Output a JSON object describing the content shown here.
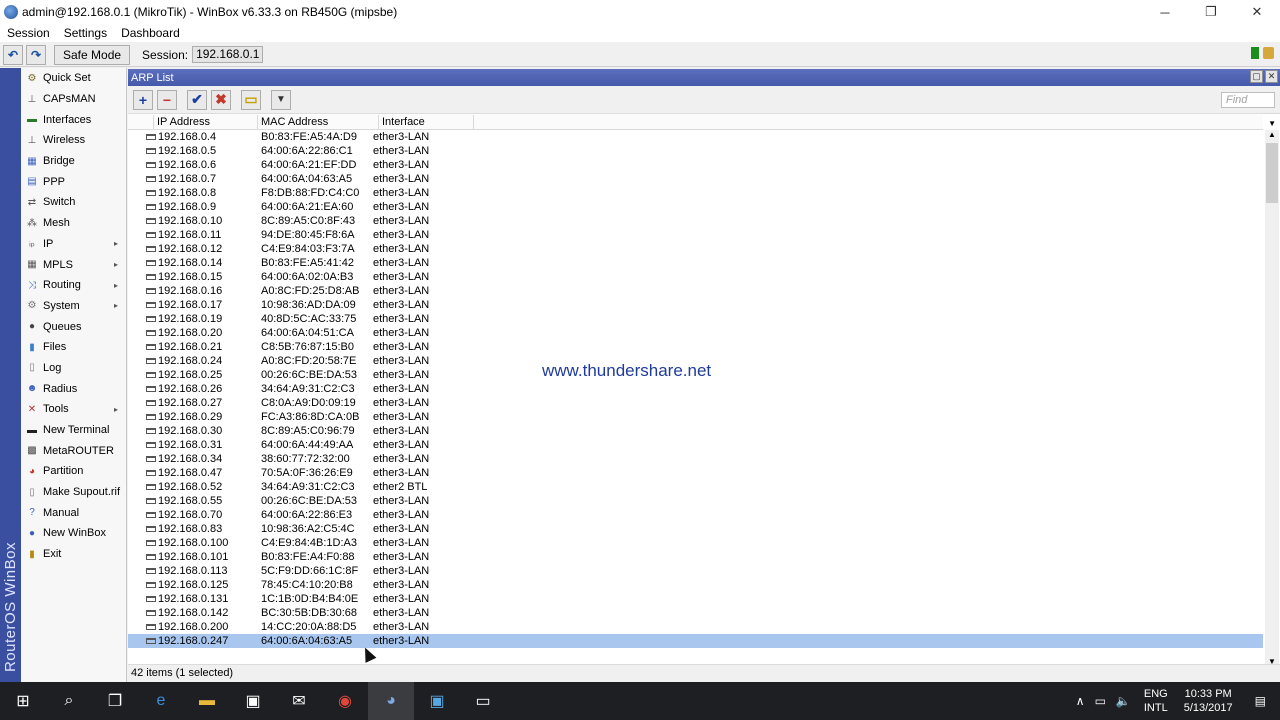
{
  "window": {
    "title": "admin@192.168.0.1 (MikroTik) - WinBox v6.33.3 on RB450G (mipsbe)",
    "minimize": "─",
    "maximize": "❐",
    "close": "✕"
  },
  "menubar": [
    "Session",
    "Settings",
    "Dashboard"
  ],
  "toolbar": {
    "undo": "↶",
    "redo": "↷",
    "safe_mode": "Safe Mode",
    "session_label": "Session:",
    "session_value": "192.168.0.1"
  },
  "brand": "RouterOS WinBox",
  "sidebar": [
    {
      "label": "Quick Set",
      "icon": "quick-set-icon",
      "glyph": "⚙",
      "color": "#7a6a2a",
      "arrow": ""
    },
    {
      "label": "CAPsMAN",
      "icon": "capsman-icon",
      "glyph": "⊥",
      "color": "#555",
      "arrow": ""
    },
    {
      "label": "Interfaces",
      "icon": "interfaces-icon",
      "glyph": "▬",
      "color": "#2a7a2a",
      "arrow": ""
    },
    {
      "label": "Wireless",
      "icon": "wireless-icon",
      "glyph": "⊥",
      "color": "#555",
      "arrow": ""
    },
    {
      "label": "Bridge",
      "icon": "bridge-icon",
      "glyph": "▦",
      "color": "#3a5fbf",
      "arrow": ""
    },
    {
      "label": "PPP",
      "icon": "ppp-icon",
      "glyph": "▤",
      "color": "#3a5fbf",
      "arrow": ""
    },
    {
      "label": "Switch",
      "icon": "switch-icon",
      "glyph": "⇄",
      "color": "#555",
      "arrow": ""
    },
    {
      "label": "Mesh",
      "icon": "mesh-icon",
      "glyph": "⁂",
      "color": "#555",
      "arrow": ""
    },
    {
      "label": "IP",
      "icon": "ip-icon",
      "glyph": "ᵢₚ",
      "color": "#555",
      "arrow": "▸"
    },
    {
      "label": "MPLS",
      "icon": "mpls-icon",
      "glyph": "▦",
      "color": "#555",
      "arrow": "▸"
    },
    {
      "label": "Routing",
      "icon": "routing-icon",
      "glyph": "⤨",
      "color": "#3a5fbf",
      "arrow": "▸"
    },
    {
      "label": "System",
      "icon": "system-icon",
      "glyph": "⚙",
      "color": "#777",
      "arrow": "▸"
    },
    {
      "label": "Queues",
      "icon": "queues-icon",
      "glyph": "●",
      "color": "#444",
      "arrow": ""
    },
    {
      "label": "Files",
      "icon": "files-icon",
      "glyph": "▮",
      "color": "#3a7fcf",
      "arrow": ""
    },
    {
      "label": "Log",
      "icon": "log-icon",
      "glyph": "▯",
      "color": "#777",
      "arrow": ""
    },
    {
      "label": "Radius",
      "icon": "radius-icon",
      "glyph": "☻",
      "color": "#3a5fbf",
      "arrow": ""
    },
    {
      "label": "Tools",
      "icon": "tools-icon",
      "glyph": "✕",
      "color": "#b33",
      "arrow": "▸"
    },
    {
      "label": "New Terminal",
      "icon": "terminal-icon",
      "glyph": "▬",
      "color": "#222",
      "arrow": ""
    },
    {
      "label": "MetaROUTER",
      "icon": "metarouter-icon",
      "glyph": "▩",
      "color": "#444",
      "arrow": ""
    },
    {
      "label": "Partition",
      "icon": "partition-icon",
      "glyph": "◕",
      "color": "#c0392b",
      "arrow": ""
    },
    {
      "label": "Make Supout.rif",
      "icon": "supout-icon",
      "glyph": "▯",
      "color": "#777",
      "arrow": ""
    },
    {
      "label": "Manual",
      "icon": "manual-icon",
      "glyph": "?",
      "color": "#3a5fbf",
      "arrow": ""
    },
    {
      "label": "New WinBox",
      "icon": "winbox-icon",
      "glyph": "●",
      "color": "#3a5fbf",
      "arrow": ""
    },
    {
      "label": "Exit",
      "icon": "exit-icon",
      "glyph": "▮",
      "color": "#b8860b",
      "arrow": ""
    }
  ],
  "arp": {
    "title": "ARP List",
    "restore": "▢",
    "close": "✕",
    "tools": {
      "add": "+",
      "remove": "−",
      "enable": "✔",
      "disable": "✖",
      "comment": "▭",
      "filter": "▼"
    },
    "find_placeholder": "Find",
    "columns": {
      "ip": "IP Address",
      "mac": "MAC Address",
      "interface": "Interface"
    },
    "rows": [
      {
        "ip": "192.168.0.4",
        "mac": "B0:83:FE:A5:4A:D9",
        "interface": "ether3-LAN",
        "selected": false
      },
      {
        "ip": "192.168.0.5",
        "mac": "64:00:6A:22:86:C1",
        "interface": "ether3-LAN",
        "selected": false
      },
      {
        "ip": "192.168.0.6",
        "mac": "64:00:6A:21:EF:DD",
        "interface": "ether3-LAN",
        "selected": false
      },
      {
        "ip": "192.168.0.7",
        "mac": "64:00:6A:04:63:A5",
        "interface": "ether3-LAN",
        "selected": false
      },
      {
        "ip": "192.168.0.8",
        "mac": "F8:DB:88:FD:C4:C0",
        "interface": "ether3-LAN",
        "selected": false
      },
      {
        "ip": "192.168.0.9",
        "mac": "64:00:6A:21:EA:60",
        "interface": "ether3-LAN",
        "selected": false
      },
      {
        "ip": "192.168.0.10",
        "mac": "8C:89:A5:C0:8F:43",
        "interface": "ether3-LAN",
        "selected": false
      },
      {
        "ip": "192.168.0.11",
        "mac": "94:DE:80:45:F8:6A",
        "interface": "ether3-LAN",
        "selected": false
      },
      {
        "ip": "192.168.0.12",
        "mac": "C4:E9:84:03:F3:7A",
        "interface": "ether3-LAN",
        "selected": false
      },
      {
        "ip": "192.168.0.14",
        "mac": "B0:83:FE:A5:41:42",
        "interface": "ether3-LAN",
        "selected": false
      },
      {
        "ip": "192.168.0.15",
        "mac": "64:00:6A:02:0A:B3",
        "interface": "ether3-LAN",
        "selected": false
      },
      {
        "ip": "192.168.0.16",
        "mac": "A0:8C:FD:25:D8:AB",
        "interface": "ether3-LAN",
        "selected": false
      },
      {
        "ip": "192.168.0.17",
        "mac": "10:98:36:AD:DA:09",
        "interface": "ether3-LAN",
        "selected": false
      },
      {
        "ip": "192.168.0.19",
        "mac": "40:8D:5C:AC:33:75",
        "interface": "ether3-LAN",
        "selected": false
      },
      {
        "ip": "192.168.0.20",
        "mac": "64:00:6A:04:51:CA",
        "interface": "ether3-LAN",
        "selected": false
      },
      {
        "ip": "192.168.0.21",
        "mac": "C8:5B:76:87:15:B0",
        "interface": "ether3-LAN",
        "selected": false
      },
      {
        "ip": "192.168.0.24",
        "mac": "A0:8C:FD:20:58:7E",
        "interface": "ether3-LAN",
        "selected": false
      },
      {
        "ip": "192.168.0.25",
        "mac": "00:26:6C:BE:DA:53",
        "interface": "ether3-LAN",
        "selected": false
      },
      {
        "ip": "192.168.0.26",
        "mac": "34:64:A9:31:C2:C3",
        "interface": "ether3-LAN",
        "selected": false
      },
      {
        "ip": "192.168.0.27",
        "mac": "C8:0A:A9:D0:09:19",
        "interface": "ether3-LAN",
        "selected": false
      },
      {
        "ip": "192.168.0.29",
        "mac": "FC:A3:86:8D:CA:0B",
        "interface": "ether3-LAN",
        "selected": false
      },
      {
        "ip": "192.168.0.30",
        "mac": "8C:89:A5:C0:96:79",
        "interface": "ether3-LAN",
        "selected": false
      },
      {
        "ip": "192.168.0.31",
        "mac": "64:00:6A:44:49:AA",
        "interface": "ether3-LAN",
        "selected": false
      },
      {
        "ip": "192.168.0.34",
        "mac": "38:60:77:72:32:00",
        "interface": "ether3-LAN",
        "selected": false
      },
      {
        "ip": "192.168.0.47",
        "mac": "70:5A:0F:36:26:E9",
        "interface": "ether3-LAN",
        "selected": false
      },
      {
        "ip": "192.168.0.52",
        "mac": "34:64:A9:31:C2:C3",
        "interface": "ether2 BTL",
        "selected": false
      },
      {
        "ip": "192.168.0.55",
        "mac": "00:26:6C:BE:DA:53",
        "interface": "ether3-LAN",
        "selected": false
      },
      {
        "ip": "192.168.0.70",
        "mac": "64:00:6A:22:86:E3",
        "interface": "ether3-LAN",
        "selected": false
      },
      {
        "ip": "192.168.0.83",
        "mac": "10:98:36:A2:C5:4C",
        "interface": "ether3-LAN",
        "selected": false
      },
      {
        "ip": "192.168.0.100",
        "mac": "C4:E9:84:4B:1D:A3",
        "interface": "ether3-LAN",
        "selected": false
      },
      {
        "ip": "192.168.0.101",
        "mac": "B0:83:FE:A4:F0:88",
        "interface": "ether3-LAN",
        "selected": false
      },
      {
        "ip": "192.168.0.113",
        "mac": "5C:F9:DD:66:1C:8F",
        "interface": "ether3-LAN",
        "selected": false
      },
      {
        "ip": "192.168.0.125",
        "mac": "78:45:C4:10:20:B8",
        "interface": "ether3-LAN",
        "selected": false
      },
      {
        "ip": "192.168.0.131",
        "mac": "1C:1B:0D:B4:B4:0E",
        "interface": "ether3-LAN",
        "selected": false
      },
      {
        "ip": "192.168.0.142",
        "mac": "BC:30:5B:DB:30:68",
        "interface": "ether3-LAN",
        "selected": false
      },
      {
        "ip": "192.168.0.200",
        "mac": "14:CC:20:0A:88:D5",
        "interface": "ether3-LAN",
        "selected": false
      },
      {
        "ip": "192.168.0.247",
        "mac": "64:00:6A:04:63:A5",
        "interface": "ether3-LAN",
        "selected": true
      }
    ],
    "status": "42 items (1 selected)"
  },
  "watermark": "www.thundershare.net",
  "taskbar": {
    "icons": [
      {
        "name": "start-icon",
        "glyph": "⊞",
        "color": "#ffffff",
        "active": false
      },
      {
        "name": "search-icon",
        "glyph": "⌕",
        "color": "#ffffff",
        "active": false
      },
      {
        "name": "task-view-icon",
        "glyph": "❐",
        "color": "#ffffff",
        "active": false
      },
      {
        "name": "edge-icon",
        "glyph": "e",
        "color": "#3c8fe0",
        "active": false
      },
      {
        "name": "file-explorer-icon",
        "glyph": "▬",
        "color": "#e8b93a",
        "active": false
      },
      {
        "name": "store-icon",
        "glyph": "▣",
        "color": "#ffffff",
        "active": false
      },
      {
        "name": "mail-icon",
        "glyph": "✉",
        "color": "#ffffff",
        "active": false
      },
      {
        "name": "chrome-icon",
        "glyph": "◉",
        "color": "#e0473b",
        "active": false
      },
      {
        "name": "winbox-task-icon",
        "glyph": "◕",
        "color": "#7fa9e6",
        "active": true
      },
      {
        "name": "network-app-icon",
        "glyph": "▣",
        "color": "#56a8e0",
        "active": false
      },
      {
        "name": "terminal-task-icon",
        "glyph": "▭",
        "color": "#ffffff",
        "active": false
      }
    ],
    "tray": {
      "chevron": "∧",
      "network": "▭",
      "volume": "🔈",
      "lang_top": "ENG",
      "lang_bottom": "INTL",
      "time": "10:33 PM",
      "date": "5/13/2017",
      "notifications": "▤"
    }
  }
}
